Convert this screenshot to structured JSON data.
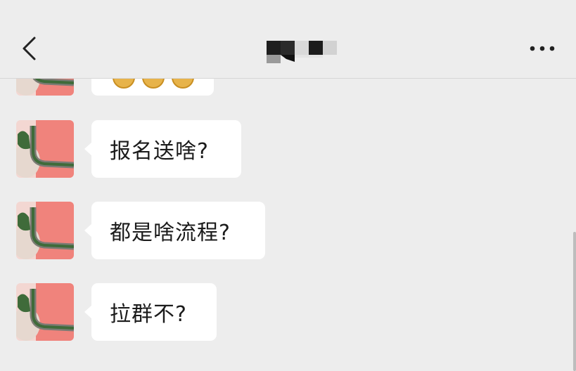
{
  "header": {
    "back_icon": "chevron-left-icon",
    "title_redacted": true,
    "more_icon": "ellipsis-icon"
  },
  "messages": [
    {
      "text": "",
      "emoji_count": 3,
      "partial": true
    },
    {
      "text": "报名送啥?"
    },
    {
      "text": "都是啥流程?"
    },
    {
      "text": "拉群不?"
    }
  ],
  "colors": {
    "background": "#ededed",
    "bubble": "#ffffff",
    "text": "#1b1b1b",
    "avatar_pink": "#f0837c",
    "avatar_green": "#3f6b3a"
  }
}
